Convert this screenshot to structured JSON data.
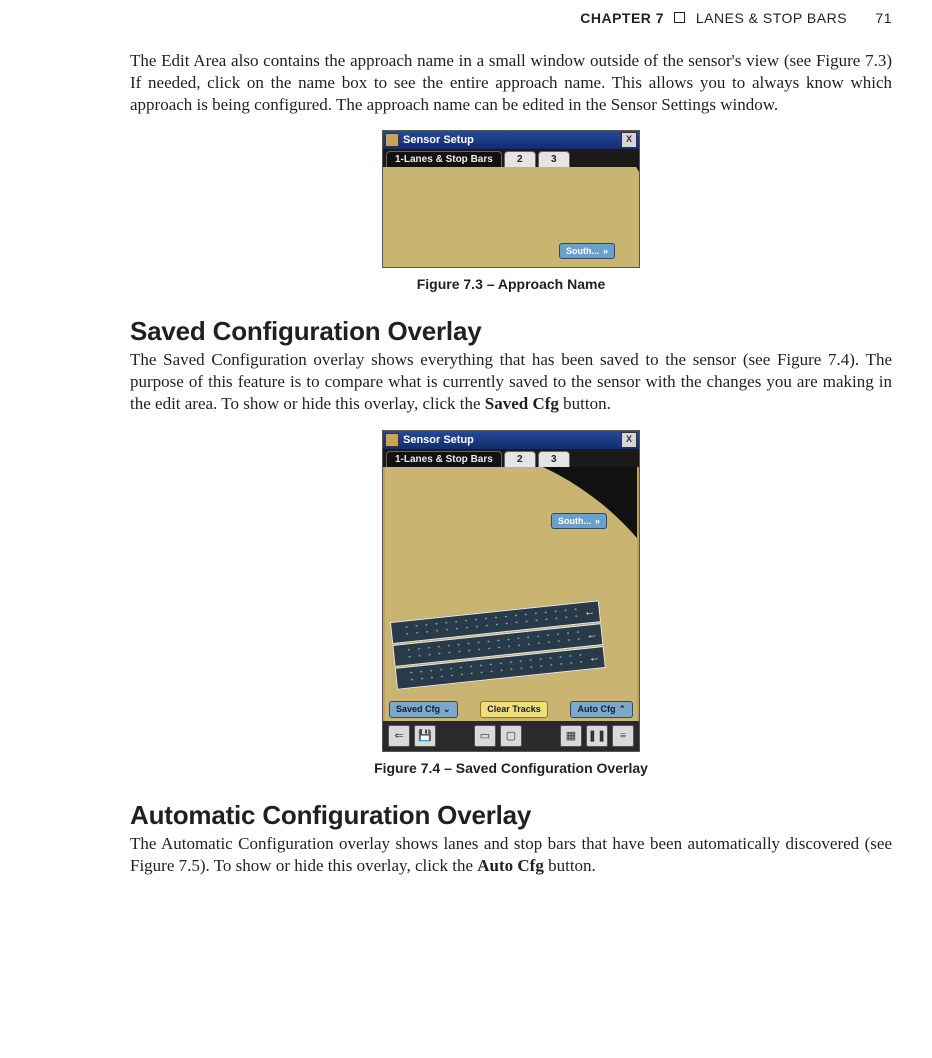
{
  "header": {
    "chapter": "CHAPTER 7",
    "title": "LANES & STOP BARS",
    "pagenum": "71"
  },
  "para1": "The Edit Area also contains the approach name in a small window outside of the sensor's view (see Figure 7.3) If needed, click on the name box to see the entire approach name. This allows you to always know which approach is being configured. The approach name can be edited in the Sensor Settings window.",
  "fig73": {
    "titlebar": "Sensor Setup",
    "tab_active": "1-Lanes & Stop Bars",
    "tab2": "2",
    "tab3": "3",
    "namebox": "South...",
    "chev": "»",
    "caption": "Figure 7.3 – Approach Name"
  },
  "section1": "Saved Configuration Overlay",
  "para2_a": "The Saved Configuration overlay shows everything that has been saved to the sensor (see Figure 7.4). The purpose of this feature is to compare what is currently saved to the sensor with the changes you are making in the edit area. To show or hide this overlay, click the ",
  "para2_bold": "Saved Cfg",
  "para2_b": " button.",
  "fig74": {
    "titlebar": "Sensor Setup",
    "tab_active": "1-Lanes & Stop Bars",
    "tab2": "2",
    "tab3": "3",
    "namebox": "South...",
    "chev": "»",
    "btn_saved": "Saved Cfg",
    "btn_clear": "Clear Tracks",
    "btn_auto": "Auto Cfg",
    "caption": "Figure 7.4 – Saved Configuration Overlay",
    "icons": {
      "back": "⇐",
      "save": "💾",
      "erase": "▭",
      "note": "▢",
      "palette": "▦",
      "pause": "❚❚",
      "menu": "≡"
    }
  },
  "section2": "Automatic Configuration Overlay",
  "para3_a": "The Automatic Configuration overlay shows lanes and stop bars that have been automatically discovered (see Figure 7.5). To show or hide this overlay, click the ",
  "para3_bold": "Auto Cfg",
  "para3_b": " button."
}
